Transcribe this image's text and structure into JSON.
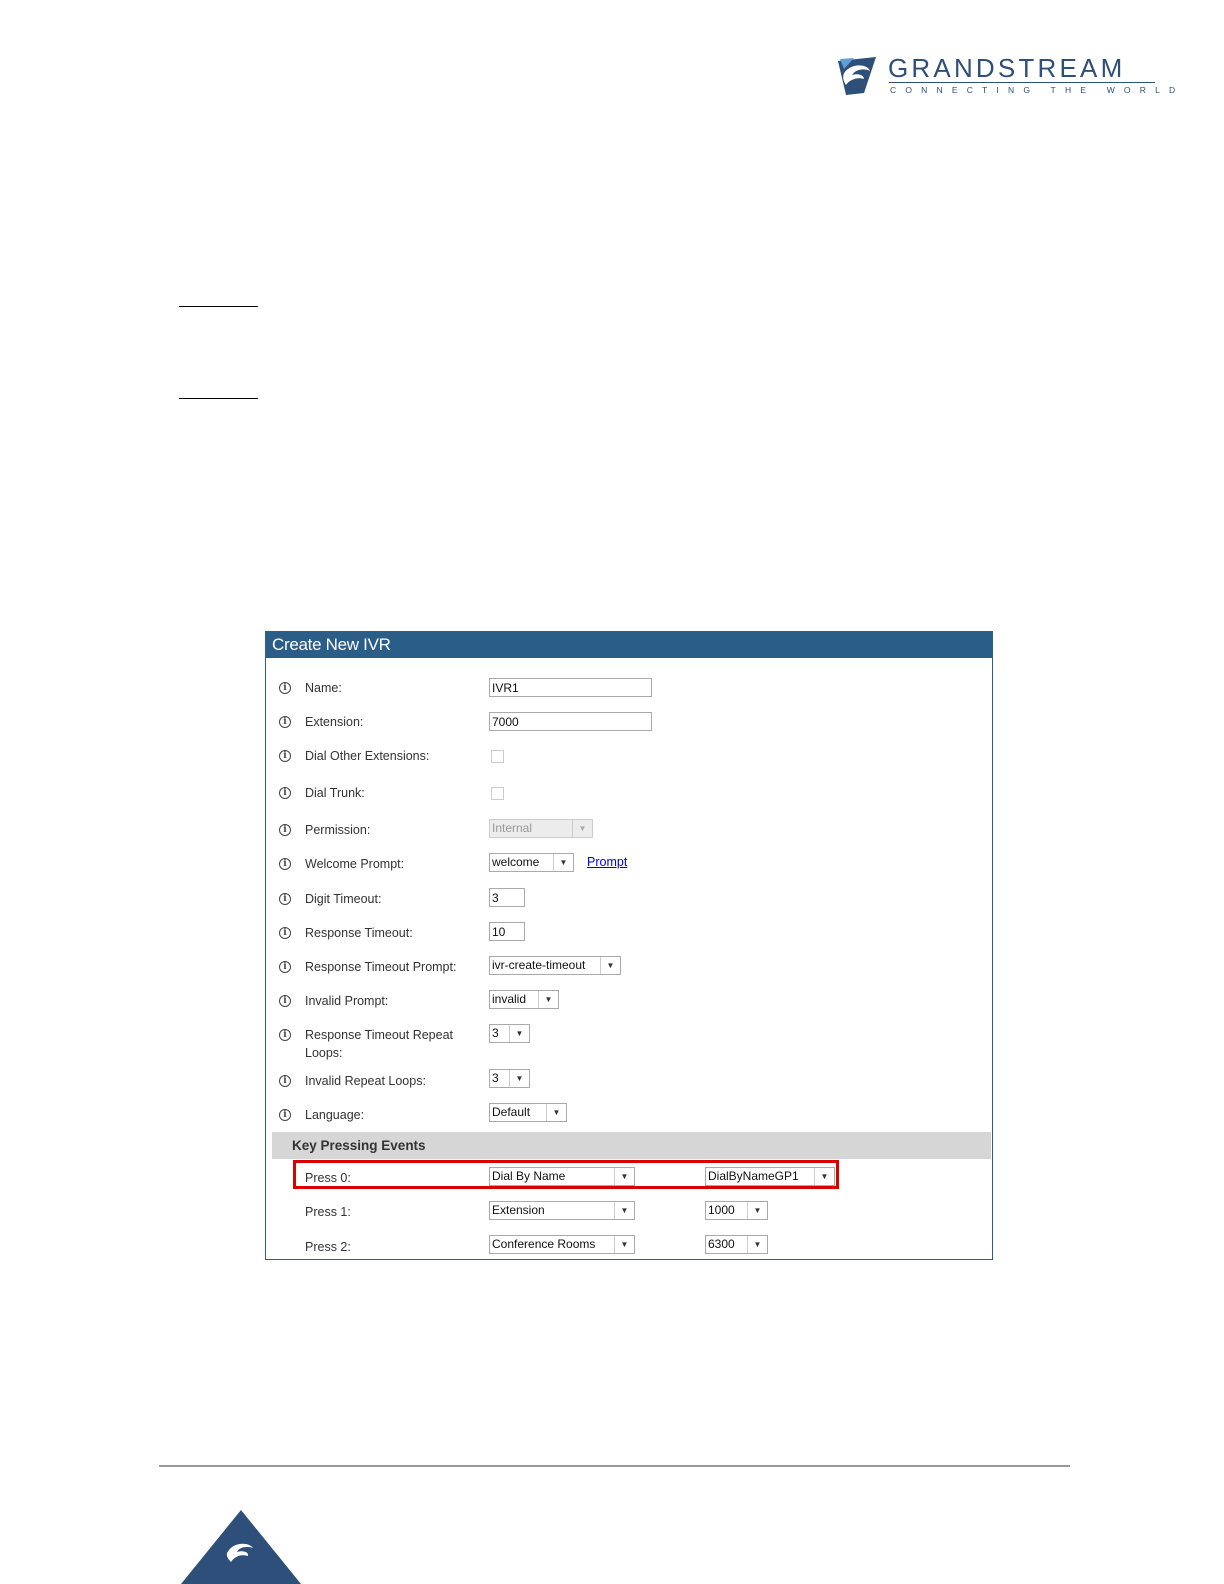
{
  "brand": {
    "name": "GRANDSTREAM",
    "tagline": "CONNECTING THE WORLD"
  },
  "dialog": {
    "title": "Create New IVR",
    "fields": {
      "name": {
        "label": "Name:",
        "value": "IVR1"
      },
      "extension": {
        "label": "Extension:",
        "value": "7000"
      },
      "dial_other_extensions": {
        "label": "Dial Other Extensions:",
        "checked": false
      },
      "dial_trunk": {
        "label": "Dial Trunk:",
        "checked": false
      },
      "permission": {
        "label": "Permission:",
        "value": "Internal"
      },
      "welcome_prompt": {
        "label": "Welcome Prompt:",
        "value": "welcome",
        "link": "Prompt"
      },
      "digit_timeout": {
        "label": "Digit Timeout:",
        "value": "3"
      },
      "response_timeout": {
        "label": "Response Timeout:",
        "value": "10"
      },
      "response_timeout_prompt": {
        "label": "Response Timeout Prompt:",
        "value": "ivr-create-timeout"
      },
      "invalid_prompt": {
        "label": "Invalid Prompt:",
        "value": "invalid"
      },
      "response_timeout_repeat_loops": {
        "label": "Response Timeout Repeat Loops:",
        "value": "3"
      },
      "invalid_repeat_loops": {
        "label": "Invalid Repeat Loops:",
        "value": "3"
      },
      "language": {
        "label": "Language:",
        "value": "Default"
      }
    },
    "key_events": {
      "title": "Key Pressing Events",
      "rows": [
        {
          "label": "Press 0:",
          "action": "Dial By Name",
          "target": "DialByNameGP1"
        },
        {
          "label": "Press 1:",
          "action": "Extension",
          "target": "1000"
        },
        {
          "label": "Press 2:",
          "action": "Conference Rooms",
          "target": "6300"
        }
      ]
    }
  },
  "colors": {
    "header": "#2b5d89",
    "brand": "#2e4f7a",
    "highlight": "#d90000",
    "section_bar": "#d6d6d6"
  }
}
